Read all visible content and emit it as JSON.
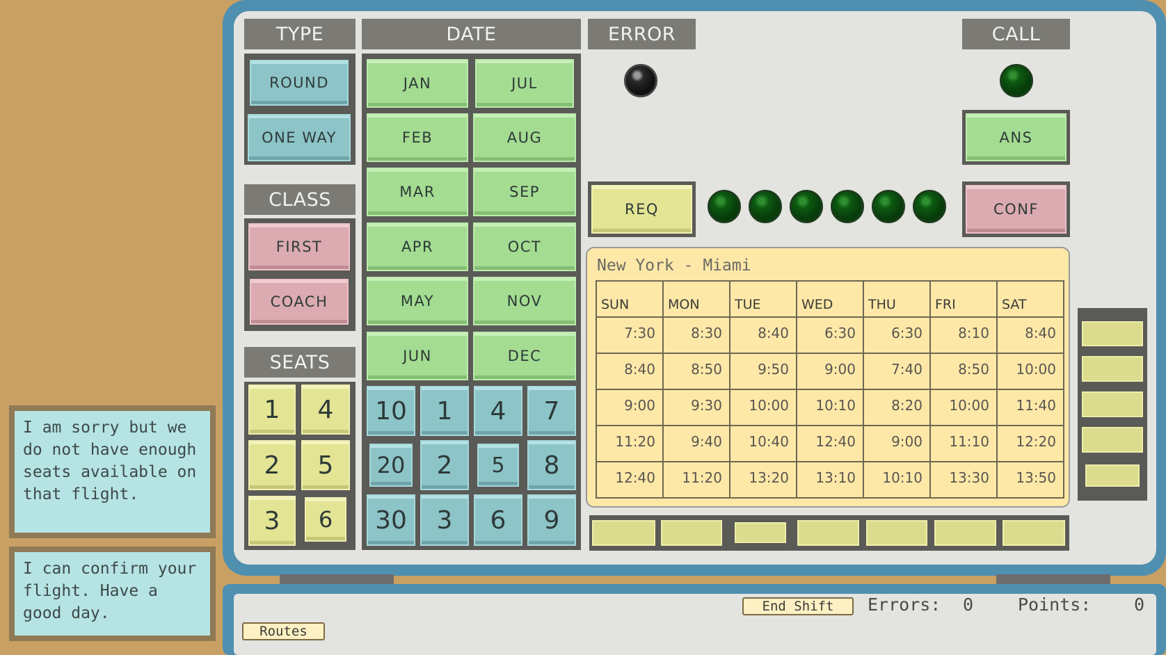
{
  "headers": {
    "type": "TYPE",
    "date": "DATE",
    "error": "ERROR",
    "call": "CALL",
    "class": "CLASS",
    "seats": "SEATS"
  },
  "type_buttons": [
    "ROUND",
    "ONE WAY"
  ],
  "class_buttons": [
    "FIRST",
    "COACH"
  ],
  "seat_buttons": [
    "1",
    "4",
    "2",
    "5",
    "3",
    "6"
  ],
  "months": [
    "JAN",
    "JUL",
    "FEB",
    "AUG",
    "MAR",
    "SEP",
    "APR",
    "OCT",
    "MAY",
    "NOV",
    "JUN",
    "DEC"
  ],
  "day_buttons": [
    "10",
    "1",
    "4",
    "7",
    "20",
    "2",
    "5",
    "8",
    "30",
    "3",
    "6",
    "9"
  ],
  "call_buttons": {
    "ans": "ANS",
    "req": "REQ",
    "conf": "CONF"
  },
  "lamp_colors": {
    "error": "#111111",
    "call": "#0d5a12",
    "row": "#0d5a12"
  },
  "schedule": {
    "route": "New York - Miami",
    "days": [
      "SUN",
      "MON",
      "TUE",
      "WED",
      "THU",
      "FRI",
      "SAT"
    ],
    "rows": [
      [
        "7:30",
        "8:30",
        "8:40",
        "6:30",
        "6:30",
        "8:10",
        "8:40"
      ],
      [
        "8:40",
        "8:50",
        "9:50",
        "9:00",
        "7:40",
        "8:50",
        "10:00"
      ],
      [
        "9:00",
        "9:30",
        "10:00",
        "10:10",
        "8:20",
        "10:00",
        "11:40"
      ],
      [
        "11:20",
        "9:40",
        "10:40",
        "12:40",
        "9:00",
        "11:10",
        "12:20"
      ],
      [
        "12:40",
        "11:20",
        "13:20",
        "13:10",
        "10:10",
        "13:30",
        "13:50"
      ]
    ]
  },
  "notes": [
    "I am sorry but we do not have enough seats available on that flight.",
    "I can confirm your flight. Have a good day."
  ],
  "bottom": {
    "end_shift": "End Shift",
    "routes": "Routes",
    "errors_label": "Errors:",
    "errors_value": "0",
    "points_label": "Points:",
    "points_value": "0"
  }
}
